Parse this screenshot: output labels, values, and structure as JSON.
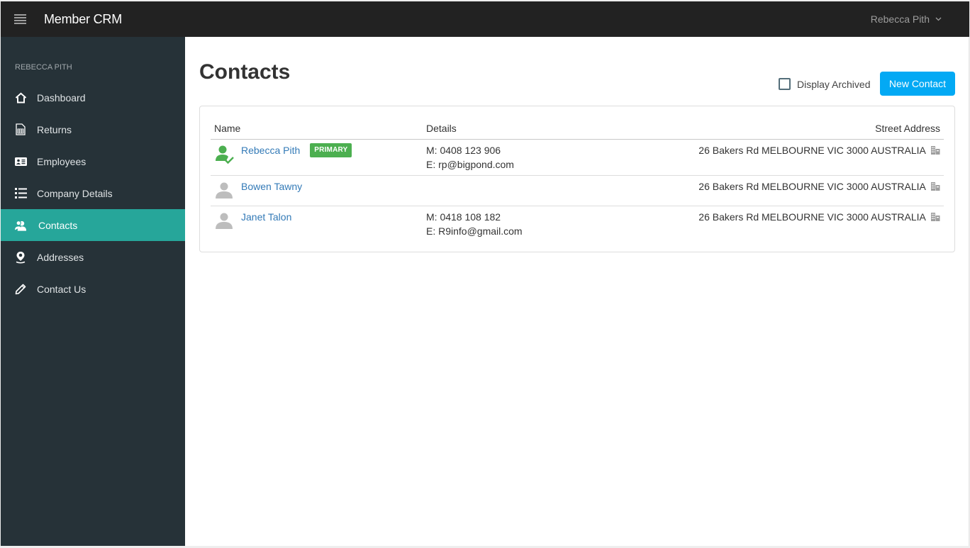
{
  "app": {
    "title": "Member CRM",
    "user_menu_label": "Rebecca Pith"
  },
  "sidebar": {
    "heading": "REBECCA PITH",
    "items": [
      {
        "label": "Dashboard",
        "icon": "home-icon",
        "active": false
      },
      {
        "label": "Returns",
        "icon": "calculator-document-icon",
        "active": false
      },
      {
        "label": "Employees",
        "icon": "id-card-icon",
        "active": false
      },
      {
        "label": "Company Details",
        "icon": "list-icon",
        "active": false
      },
      {
        "label": "Contacts",
        "icon": "contacts-icon",
        "active": true
      },
      {
        "label": "Addresses",
        "icon": "map-pin-icon",
        "active": false
      },
      {
        "label": "Contact Us",
        "icon": "pencil-icon",
        "active": false
      }
    ]
  },
  "main": {
    "title": "Contacts",
    "display_archived_label": "Display Archived",
    "display_archived_checked": false,
    "new_contact_label": "New Contact",
    "table": {
      "columns": [
        "Name",
        "Details",
        "Street Address"
      ],
      "rows": [
        {
          "name": "Rebecca Pith",
          "badge": "PRIMARY",
          "avatar": "primary-user-icon",
          "mobile": "M: 0408 123 906",
          "email": "E: rp@bigpond.com",
          "address": "26 Bakers Rd MELBOURNE VIC 3000 AUSTRALIA",
          "address_icon": "building-icon"
        },
        {
          "name": "Bowen Tawny",
          "badge": "",
          "avatar": "user-icon",
          "mobile": "",
          "email": "",
          "address": "26 Bakers Rd MELBOURNE VIC 3000 AUSTRALIA",
          "address_icon": "building-icon"
        },
        {
          "name": "Janet Talon",
          "badge": "",
          "avatar": "user-icon",
          "mobile": "M: 0418 108 182",
          "email": "E: R9info@gmail.com",
          "address": "26 Bakers Rd MELBOURNE VIC 3000 AUSTRALIA",
          "address_icon": "building-icon"
        }
      ]
    }
  },
  "colors": {
    "topbar": "#222222",
    "sidebar": "#263238",
    "active_nav": "#26a69a",
    "primary_button": "#03a9f4",
    "badge": "#4caf50",
    "link": "#337ab7"
  }
}
